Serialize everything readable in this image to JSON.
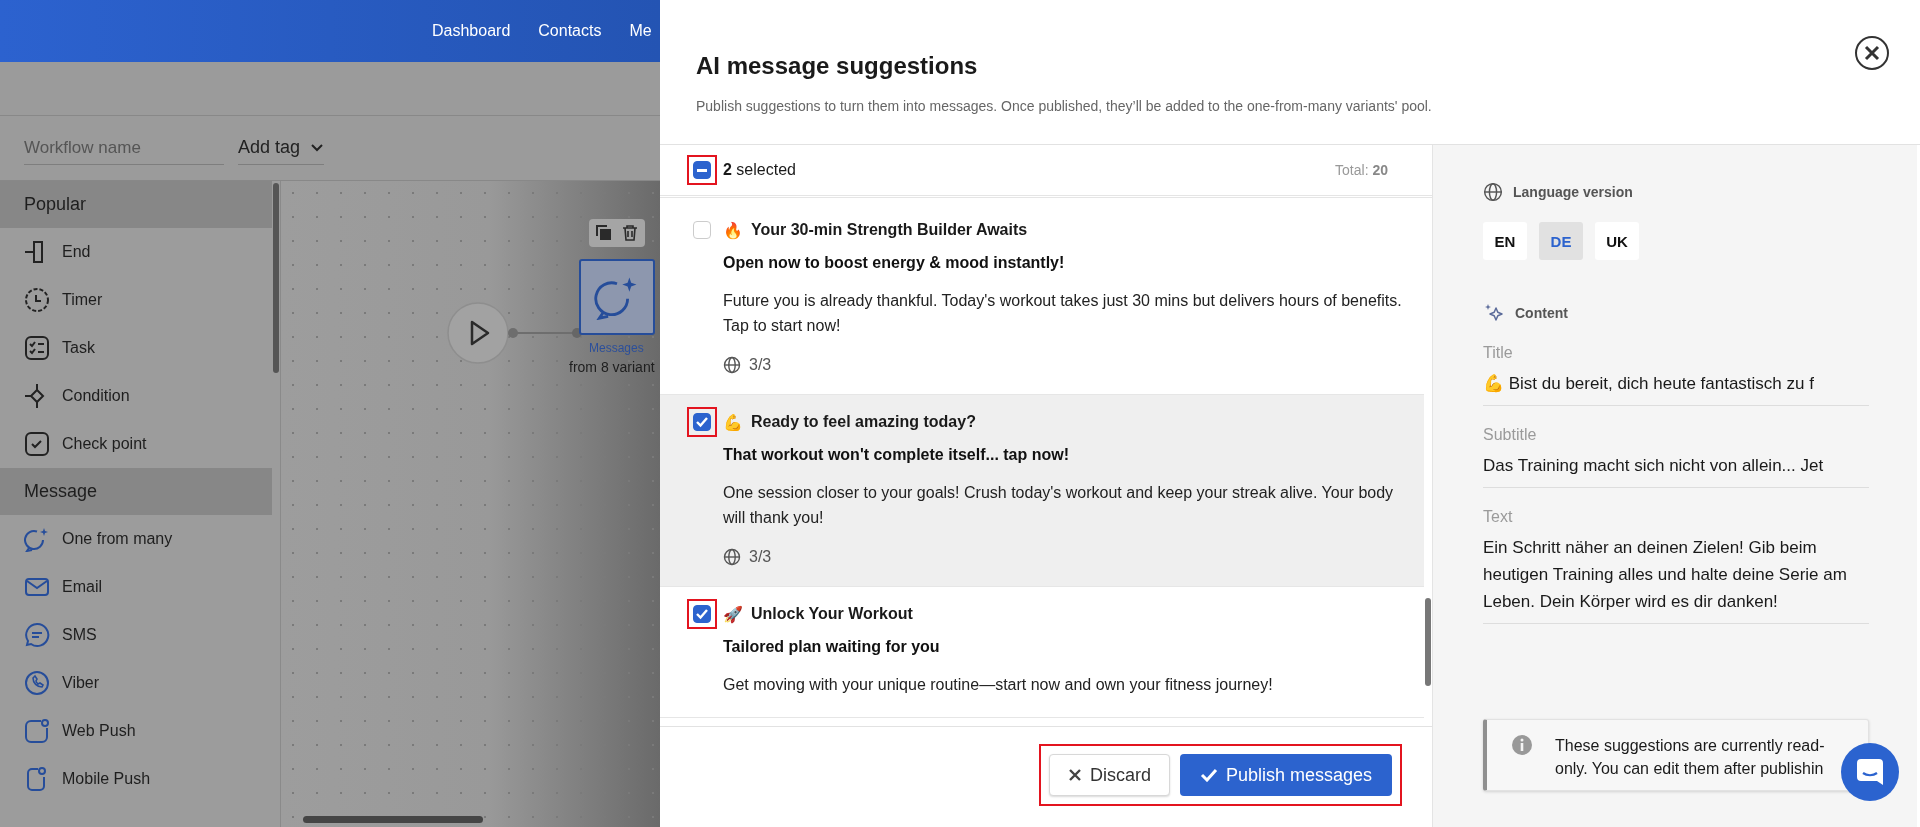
{
  "nav": {
    "links": [
      "Dashboard",
      "Contacts",
      "Me"
    ]
  },
  "toolbar": {
    "name_placeholder": "Workflow name",
    "tag_button": "Add tag"
  },
  "sidebar": {
    "sections": [
      {
        "title": "Popular",
        "items": [
          {
            "label": "End",
            "kind": "end"
          },
          {
            "label": "Timer",
            "kind": "timer"
          },
          {
            "label": "Task",
            "kind": "task"
          },
          {
            "label": "Condition",
            "kind": "condition"
          },
          {
            "label": "Check point",
            "kind": "checkpoint"
          }
        ]
      },
      {
        "title": "Message",
        "items": [
          {
            "label": "One from many",
            "kind": "sparkle"
          },
          {
            "label": "Email",
            "kind": "email"
          },
          {
            "label": "SMS",
            "kind": "sms"
          },
          {
            "label": "Viber",
            "kind": "viber"
          },
          {
            "label": "Web Push",
            "kind": "web_push"
          },
          {
            "label": "Mobile Push",
            "kind": "mobile_push"
          }
        ]
      }
    ]
  },
  "canvas": {
    "node": {
      "label": "Messages",
      "caption": "from 8 variant"
    }
  },
  "modal": {
    "title": "AI message suggestions",
    "description": "Publish suggestions to turn them into messages. Once published, they’ll be added to the one-from-many variants' pool.",
    "select_all": {
      "indeterminate": true,
      "highlighted": true,
      "label": "**2** selected"
    },
    "total_label": "Total:",
    "total": "20",
    "items": [
      {
        "emoji": "🔥",
        "title": "Your 30-min Strength Builder Awaits",
        "subtitle": "Open now to boost energy & mood instantly!",
        "text": "Future you is already thankful. Today's workout takes just 30 mins but delivers hours of benefits. Tap to start now!",
        "languages": "3/3",
        "checked": false,
        "selected": false,
        "highlighted": false
      },
      {
        "emoji": "💪",
        "title": "Ready to feel amazing today?",
        "subtitle": "That workout won't complete itself... tap now!",
        "text": "One session closer to your goals! Crush today's workout and keep your streak alive. Your body will thank you!",
        "languages": "3/3",
        "checked": true,
        "selected": true,
        "highlighted": true
      },
      {
        "emoji": "🚀",
        "title": "Unlock Your Workout",
        "subtitle": "Tailored plan waiting for you",
        "text": "Get moving with your unique routine—start now and own your fitness journey!",
        "checked": true,
        "selected": false,
        "highlighted": true
      }
    ],
    "footer": {
      "highlighted": true,
      "discard": "Discard",
      "publish": "Publish messages"
    },
    "details": {
      "language_label": "Language version",
      "languages": [
        {
          "code": "EN",
          "selected": false
        },
        {
          "code": "DE",
          "selected": true
        },
        {
          "code": "UK",
          "selected": false
        }
      ],
      "content_label": "Content",
      "fields": [
        {
          "label": "Title",
          "value": "💪 Bist du bereit, dich heute fantastisch zu f"
        },
        {
          "label": "Subtitle",
          "value": "Das Training macht sich nicht von allein... Jet"
        },
        {
          "label": "Text",
          "value": "Ein Schritt näher an deinen Zielen! Gib beim heutigen Training alles und halte deine Serie am Leben. Dein Körper wird es dir danken!"
        }
      ],
      "notice": "These suggestions are currently read-only. You can edit them after publishin"
    }
  }
}
